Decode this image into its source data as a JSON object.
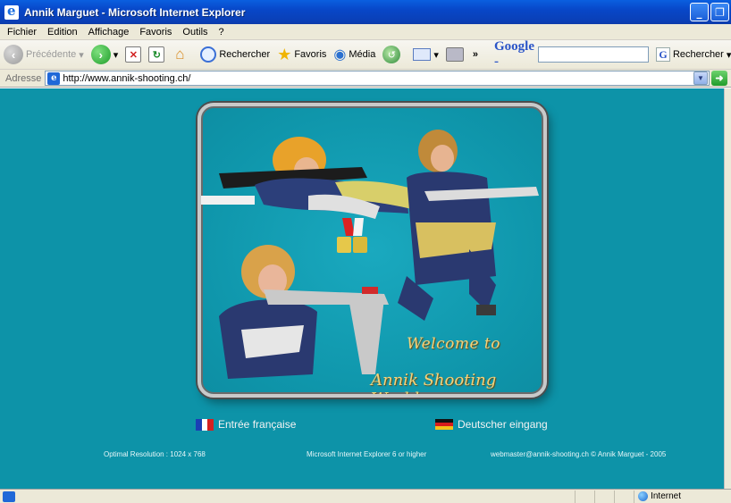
{
  "window": {
    "title": "Annik Marguet - Microsoft Internet Explorer",
    "minimize_glyph": "_",
    "restore_glyph": "❐"
  },
  "menu": [
    "Fichier",
    "Edition",
    "Affichage",
    "Favoris",
    "Outils",
    "?"
  ],
  "toolbar": {
    "back_label": "Précédente",
    "search_label": "Rechercher",
    "favorites_label": "Favoris",
    "media_label": "Média",
    "more_glyph": "»",
    "google_label": "Google -",
    "google_search_label": "Rechercher",
    "google_search_value": ""
  },
  "address": {
    "label": "Adresse",
    "url": "http://www.annik-shooting.ch/"
  },
  "page": {
    "welcome_line1": "Welcome to",
    "welcome_line2": "Annik Shooting World",
    "lang_fr": "Entrée française",
    "lang_de": "Deutscher eingang",
    "footer_resolution": "Optimal Resolution : 1024 x 768",
    "footer_browser": "Microsoft Internet Explorer 6 or higher",
    "footer_contact": "webmaster@annik-shooting.ch © Annik Marguet - 2005",
    "background_color": "#0d93a8",
    "text_accent_color": "#f4d27a"
  },
  "status": {
    "zone": "Internet"
  }
}
